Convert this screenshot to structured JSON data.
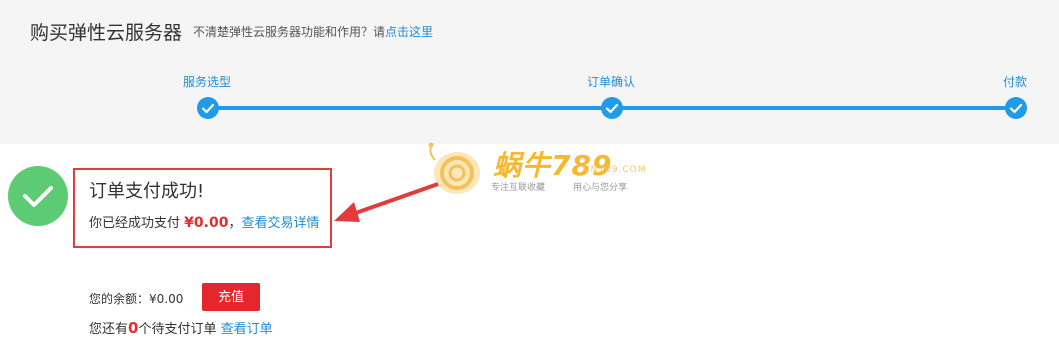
{
  "header": {
    "title": "购买弹性云服务器",
    "hint_text": "不清楚弹性云服务器功能和作用？请",
    "hint_link": "点击这里"
  },
  "steps": [
    {
      "label": "服务选型",
      "status": "done"
    },
    {
      "label": "订单确认",
      "status": "done"
    },
    {
      "label": "付款",
      "status": "done"
    }
  ],
  "success": {
    "title": "订单支付成功!",
    "paid_prefix": "你已经成功支付",
    "amount": "¥0.00",
    "separator": "，",
    "detail_link": "查看交易详情"
  },
  "balance": {
    "label": "您的余额：",
    "value": "¥0.00",
    "recharge_label": "充值"
  },
  "pending": {
    "prefix": "您还有",
    "count": "0",
    "suffix": "个待支付订单",
    "link": "查看订单"
  },
  "watermark": {
    "brand": "蜗牛789",
    "domain": "UN789.COM",
    "slogan_left": "专注互联收藏",
    "slogan_right": "用心与您分享"
  },
  "colors": {
    "accent": "#1f9bea",
    "link": "#1f8dd6",
    "success": "#5dcb74",
    "danger": "#e6252d",
    "highlight_border": "#e23b3b"
  }
}
